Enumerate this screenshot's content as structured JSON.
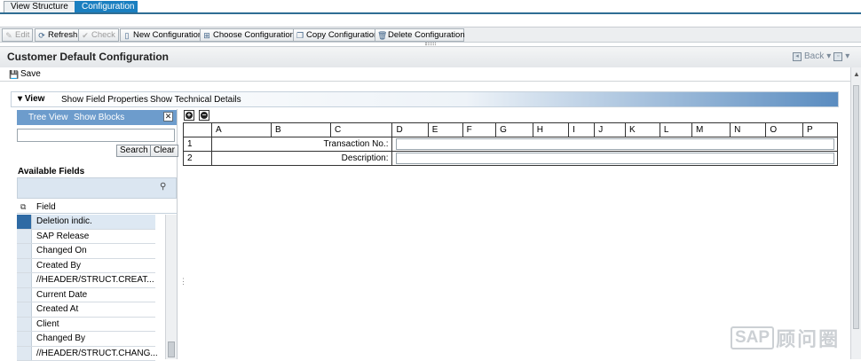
{
  "tabs": [
    "View Structure",
    "Configuration"
  ],
  "toolbar": {
    "edit": "Edit",
    "refresh": "Refresh",
    "check": "Check",
    "new_configuration": "New Configuration",
    "choose_configuration": "Choose Configuration",
    "copy_configuration": "Copy Configuration",
    "delete_configuration": "Delete Configuration"
  },
  "page": {
    "title": "Customer Default Configuration",
    "save": "Save",
    "back": "Back"
  },
  "view_bar": {
    "label": "View",
    "show_field_properties": "Show Field Properties",
    "show_technical_details": "Show Technical Details"
  },
  "left_panel": {
    "tree_view": "Tree View",
    "show_blocks": "Show Blocks",
    "close": "✕",
    "search_value": "",
    "search_button": "Search",
    "clear_button": "Clear",
    "available_fields": "Available Fields",
    "field_header": "Field",
    "fields": [
      "Deletion indic.",
      "SAP Release",
      "Changed On",
      "Created By",
      "//HEADER/STRUCT.CREAT...",
      "Current Date",
      "Created At",
      "Client",
      "Changed By",
      "//HEADER/STRUCT.CHANG..."
    ],
    "selected_index": 0
  },
  "grid": {
    "columns": [
      "A",
      "B",
      "C",
      "D",
      "E",
      "F",
      "G",
      "H",
      "I",
      "J",
      "K",
      "L",
      "M",
      "N",
      "O",
      "P"
    ],
    "rows": [
      {
        "num": "1",
        "label": "Transaction No.:",
        "value": ""
      },
      {
        "num": "2",
        "label": "Description:",
        "value": ""
      }
    ]
  },
  "watermark": {
    "box": "SAP",
    "text": "顾问圈"
  },
  "colors": {
    "tab_active": "#1a7fc0",
    "panel_header": "#6d9ccc",
    "selection": "#2e6aa4"
  }
}
